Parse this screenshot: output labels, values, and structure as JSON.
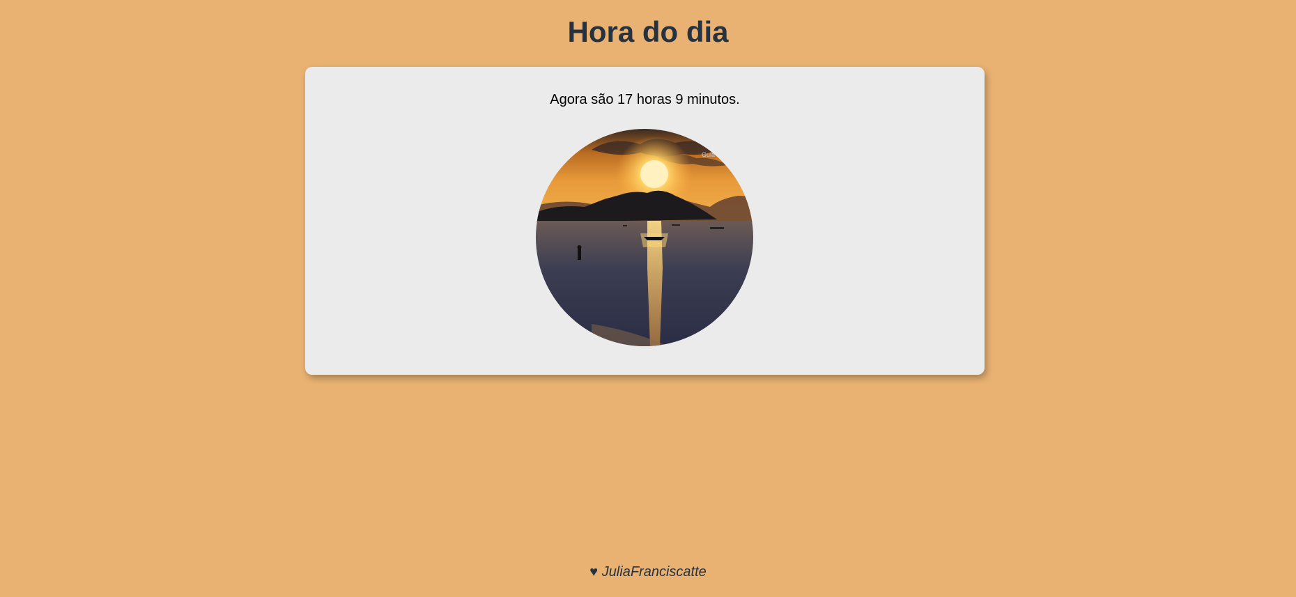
{
  "page": {
    "title": "Hora do dia",
    "background_color": "#E9B272"
  },
  "card": {
    "time_message": "Agora são 17 horas 9 minutos.",
    "image": {
      "icon": "sunset-photo",
      "description_hidden": true
    }
  },
  "footer": {
    "heart_icon": "♥",
    "author": "JuliaFranciscatte"
  },
  "colors": {
    "title": "#263240",
    "card_background": "#EBEBEB"
  }
}
